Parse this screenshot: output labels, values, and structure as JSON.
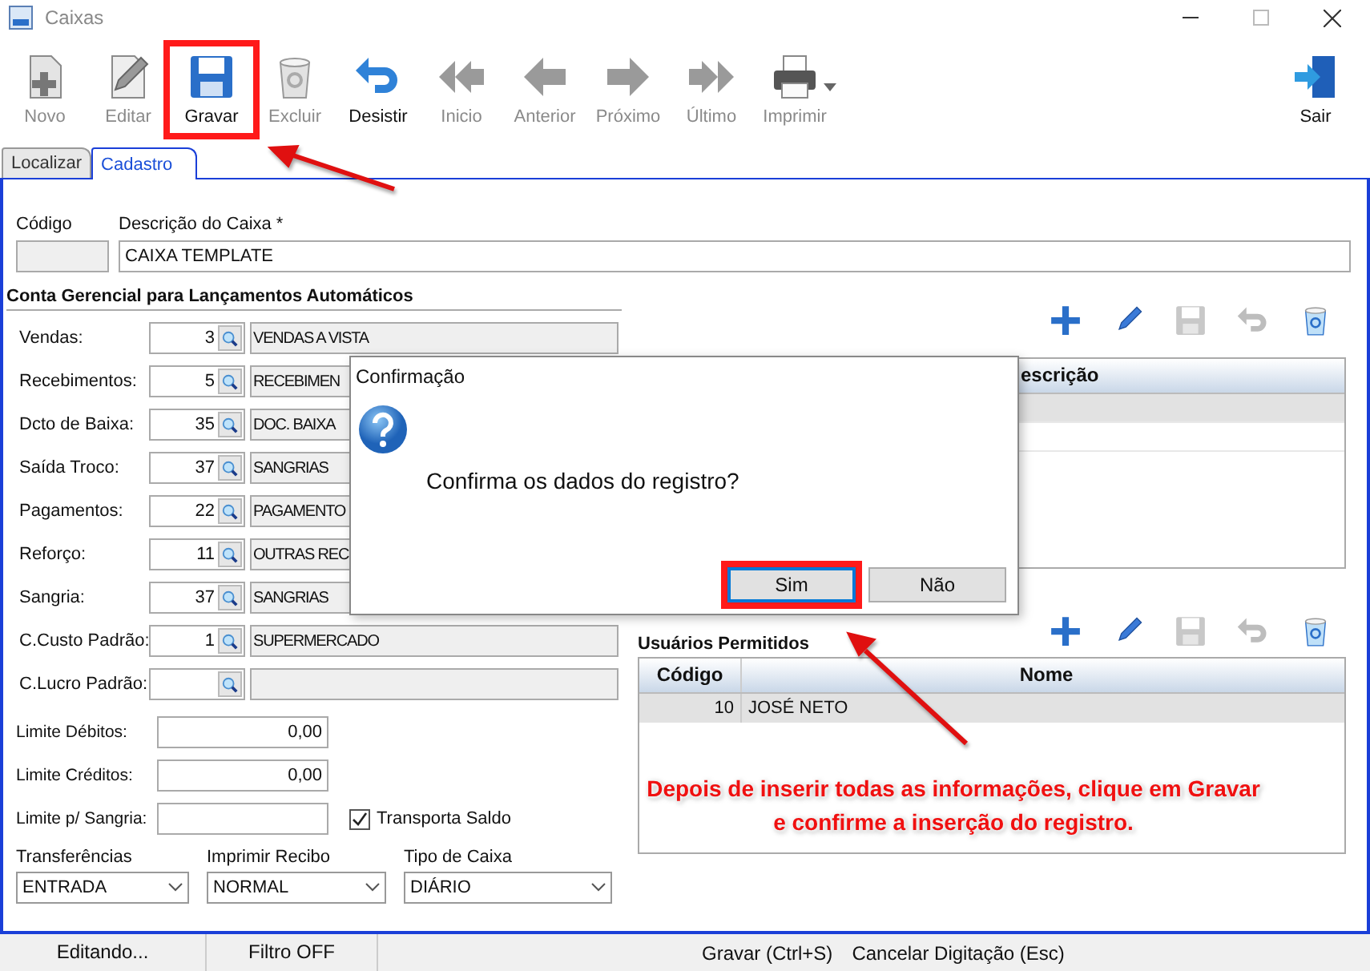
{
  "window": {
    "title": "Caixas"
  },
  "toolbar": [
    {
      "kind": "new",
      "label": "Novo",
      "disabled": true,
      "highlighted": false
    },
    {
      "kind": "edit",
      "label": "Editar",
      "disabled": true,
      "highlighted": false
    },
    {
      "kind": "save",
      "label": "Gravar",
      "disabled": false,
      "highlighted": true
    },
    {
      "kind": "delete",
      "label": "Excluir",
      "disabled": true,
      "highlighted": false
    },
    {
      "kind": "undo",
      "label": "Desistir",
      "disabled": false,
      "highlighted": false
    },
    {
      "kind": "first",
      "label": "Inicio",
      "disabled": true,
      "highlighted": false
    },
    {
      "kind": "prev",
      "label": "Anterior",
      "disabled": true,
      "highlighted": false
    },
    {
      "kind": "next",
      "label": "Próximo",
      "disabled": true,
      "highlighted": false
    },
    {
      "kind": "last",
      "label": "Último",
      "disabled": true,
      "highlighted": false
    },
    {
      "kind": "print",
      "label": "Imprimir",
      "disabled": true,
      "highlighted": false
    },
    {
      "kind": "exit",
      "label": "Sair",
      "disabled": false,
      "highlighted": false
    }
  ],
  "tabs": [
    {
      "label": "Localizar",
      "selected": false
    },
    {
      "label": "Cadastro",
      "selected": true
    }
  ],
  "codigo": {
    "label": "Código"
  },
  "descricao": {
    "label": "Descrição do Caixa *",
    "value": "CAIXA TEMPLATE"
  },
  "section_title": "Conta Gerencial para Lançamentos Automáticos",
  "accounts": [
    {
      "label": "Vendas:",
      "code": "3",
      "name": "VENDAS A VISTA"
    },
    {
      "label": "Recebimentos:",
      "code": "5",
      "name": "RECEBIMEN"
    },
    {
      "label": "Dcto de Baixa:",
      "code": "35",
      "name": "DOC. BAIXA"
    },
    {
      "label": "Saída Troco:",
      "code": "37",
      "name": "SANGRIAS"
    },
    {
      "label": "Pagamentos:",
      "code": "22",
      "name": "PAGAMENTO"
    },
    {
      "label": "Reforço:",
      "code": "11",
      "name": "OUTRAS REC"
    },
    {
      "label": "Sangria:",
      "code": "37",
      "name": "SANGRIAS"
    },
    {
      "label": "C.Custo Padrão:",
      "code": "1",
      "name": "SUPERMERCADO"
    },
    {
      "label": "C.Lucro Padrão:"
    }
  ],
  "limits": [
    {
      "label": "Limite Débitos:",
      "value": "0,00"
    },
    {
      "label": "Limite Créditos:",
      "value": "0,00"
    },
    {
      "label": "Limite p/ Sangria:"
    }
  ],
  "transporta_saldo": {
    "label": "Transporta Saldo",
    "checked": true
  },
  "selects": [
    {
      "label": "Transferências",
      "value": "ENTRADA"
    },
    {
      "label": "Imprimir Recibo",
      "value": "NORMAL"
    },
    {
      "label": "Tipo de Caixa",
      "value": "DIÁRIO"
    }
  ],
  "upper_grid": {
    "tools": [
      {
        "kind": "add",
        "disabled": false
      },
      {
        "kind": "edit",
        "disabled": false
      },
      {
        "kind": "save",
        "disabled": true
      },
      {
        "kind": "undo",
        "disabled": true
      },
      {
        "kind": "delete",
        "disabled": false
      }
    ],
    "column": "escrição",
    "rows": [
      {
        "selected": true
      },
      {
        "selected": false
      }
    ]
  },
  "users": {
    "title": "Usuários Permitidos",
    "tools": [
      {
        "kind": "add",
        "disabled": false
      },
      {
        "kind": "edit",
        "disabled": false
      },
      {
        "kind": "save",
        "disabled": true
      },
      {
        "kind": "undo",
        "disabled": true
      },
      {
        "kind": "delete",
        "disabled": false
      }
    ],
    "columns": [
      "Código",
      "Nome"
    ],
    "rows": [
      {
        "codigo": "10",
        "nome": "JOSÉ NETO",
        "selected": true
      }
    ]
  },
  "dialog": {
    "title": "Confirmação",
    "message": "Confirma os dados do registro?",
    "buttons": [
      {
        "label": "Sim",
        "selected": true,
        "highlighted": true
      },
      {
        "label": "Não",
        "selected": false,
        "highlighted": false
      }
    ]
  },
  "annotation": [
    "Depois de inserir todas as informações, clique em Gravar",
    "e confirme a inserção do registro."
  ],
  "status_bar": [
    "Editando...",
    "Filtro OFF",
    "Gravar (Ctrl+S)",
    "Cancelar Digitação (Esc)"
  ]
}
